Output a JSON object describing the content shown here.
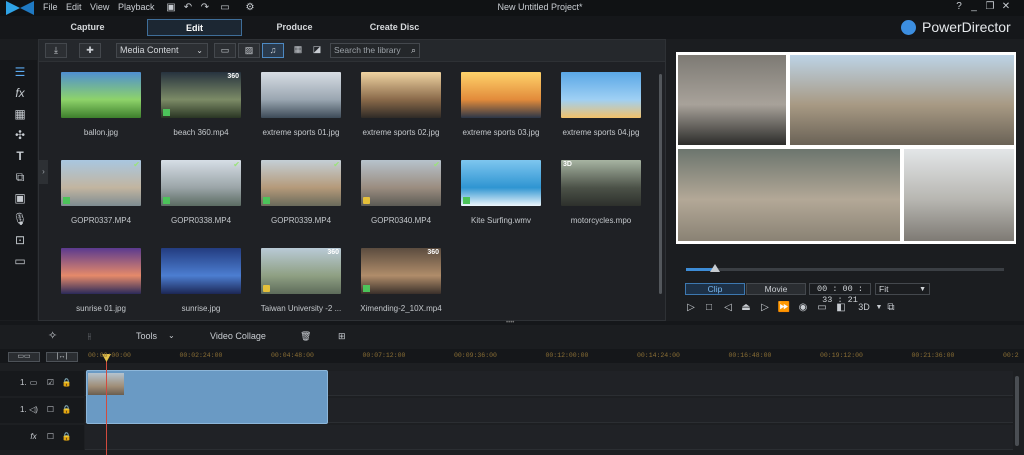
{
  "menu": [
    "File",
    "Edit",
    "View",
    "Playback"
  ],
  "window_title": "New Untitled Project*",
  "window_controls": [
    "?",
    "_",
    "❐",
    "✕"
  ],
  "tabs": [
    {
      "label": "Capture",
      "active": false
    },
    {
      "label": "Edit",
      "active": true
    },
    {
      "label": "Produce",
      "active": false
    },
    {
      "label": "Create Disc",
      "active": false
    }
  ],
  "brand": "PowerDirector",
  "library": {
    "filter": "Media Content",
    "search_placeholder": "Search the library",
    "items": [
      {
        "name": "ballon.jpg",
        "badge": "",
        "type": "photo",
        "colors": [
          "#4f8fd1",
          "#8ed36a",
          "#3d7f2c"
        ]
      },
      {
        "name": "beach 360.mp4",
        "badge": "360",
        "type": "video",
        "colors": [
          "#27333f",
          "#7c8b66",
          "#2a3624"
        ]
      },
      {
        "name": "extreme sports 01.jpg",
        "badge": "",
        "type": "photo",
        "colors": [
          "#d7dde4",
          "#9aa6b1",
          "#3d4b58"
        ]
      },
      {
        "name": "extreme sports 02.jpg",
        "badge": "",
        "type": "photo",
        "colors": [
          "#f0d4a2",
          "#8a6a4a",
          "#2f2a26"
        ]
      },
      {
        "name": "extreme sports 03.jpg",
        "badge": "",
        "type": "photo",
        "colors": [
          "#ffd36b",
          "#e28b3b",
          "#2b3647"
        ]
      },
      {
        "name": "extreme sports 04.jpg",
        "badge": "",
        "type": "photo",
        "colors": [
          "#5aa7e6",
          "#9fd0f4",
          "#f2c26a"
        ]
      },
      {
        "name": "GOPR0337.MP4",
        "badge": "",
        "type": "video",
        "colors": [
          "#a9c7e0",
          "#c2b5a0",
          "#7e8c92"
        ]
      },
      {
        "name": "GOPR0338.MP4",
        "badge": "",
        "type": "video",
        "colors": [
          "#d6dee6",
          "#9ba5a8",
          "#5b6b62"
        ]
      },
      {
        "name": "GOPR0339.MP4",
        "badge": "",
        "type": "video",
        "colors": [
          "#c4cfd6",
          "#b59a7a",
          "#6a6a5b"
        ]
      },
      {
        "name": "GOPR0340.MP4",
        "badge": "",
        "type": "audio",
        "colors": [
          "#b7c3cc",
          "#9b8d80",
          "#5c5b55"
        ]
      },
      {
        "name": "Kite Surfing.wmv",
        "badge": "",
        "type": "video",
        "colors": [
          "#7ec6ef",
          "#2f95d2",
          "#eef6fb"
        ]
      },
      {
        "name": "motorcycles.mpo",
        "badge": "3D",
        "type": "photo",
        "colors": [
          "#a7b4a2",
          "#4c5248",
          "#2d302c"
        ]
      },
      {
        "name": "sunrise 01.jpg",
        "badge": "",
        "type": "photo",
        "colors": [
          "#5a3a8f",
          "#e58a6a",
          "#2b2a5a"
        ]
      },
      {
        "name": "sunrise.jpg",
        "badge": "",
        "type": "photo",
        "colors": [
          "#233c80",
          "#4c7ed1",
          "#1c2755"
        ]
      },
      {
        "name": "Taiwan University -2 ...",
        "badge": "360",
        "type": "audio",
        "colors": [
          "#b9cad6",
          "#8fa083",
          "#5d6b5a"
        ]
      },
      {
        "name": "Ximending-2_10X.mp4",
        "badge": "360",
        "type": "video",
        "colors": [
          "#5b4c3f",
          "#b08d6a",
          "#3a302a"
        ]
      }
    ]
  },
  "preview": {
    "mode_clip": "Clip",
    "mode_movie": "Movie",
    "timecode": "00 : 00 : 33 : 21",
    "fit": "Fit",
    "three_d": "3D",
    "cells": [
      {
        "colors": [
          "#7d7a74",
          "#a8a29a",
          "#2c2c2a"
        ]
      },
      {
        "colors": [
          "#bcd3e6",
          "#a89a84",
          "#6a6256"
        ]
      },
      {
        "colors": [
          "#6c756e",
          "#b3a897",
          "#8a8274"
        ]
      },
      {
        "colors": [
          "#e3e6e8",
          "#b7b6b1",
          "#7e7a74"
        ]
      }
    ]
  },
  "timeline_toolbar": {
    "tools": "Tools",
    "video_collage": "Video Collage"
  },
  "ruler": {
    "ticks": [
      "00:00:00:00",
      "00:02:24:00",
      "00:04:48:00",
      "00:07:12:00",
      "00:09:36:00",
      "00:12:00:00",
      "00:14:24:00",
      "00:16:48:00",
      "00:19:12:00",
      "00:21:36:00",
      "00:2"
    ]
  },
  "tracks": [
    {
      "label": "1."
    },
    {
      "label": "1."
    },
    {
      "label": ""
    }
  ]
}
